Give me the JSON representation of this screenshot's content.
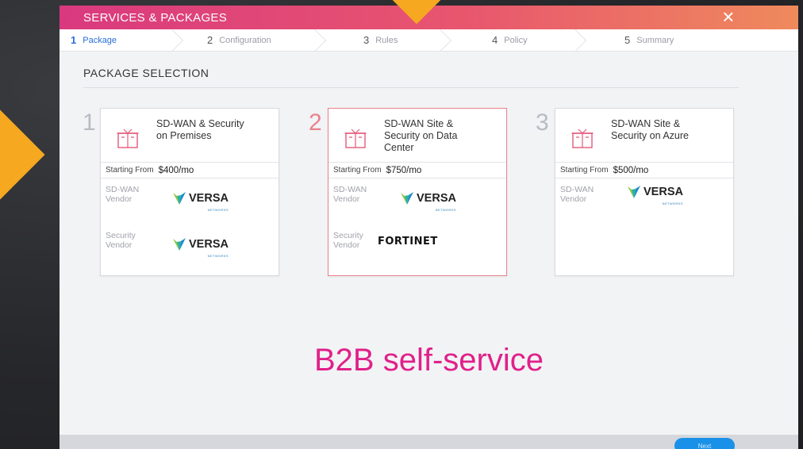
{
  "window": {
    "title": "SERVICES & PACKAGES"
  },
  "steps": [
    {
      "num": "1",
      "label": "Package"
    },
    {
      "num": "2",
      "label": "Configuration"
    },
    {
      "num": "3",
      "label": "Rules"
    },
    {
      "num": "4",
      "label": "Policy"
    },
    {
      "num": "5",
      "label": "Summary"
    }
  ],
  "section": {
    "title": "PACKAGE SELECTION"
  },
  "packages": [
    {
      "index": "1",
      "name": "SD-WAN & Security on Premises",
      "price_label": "Starting From",
      "price": "$400/mo",
      "sdwan_label": "SD-WAN Vendor",
      "sdwan_vendor": "VERSA",
      "sdwan_vendor_sub": "NETWORKS",
      "security_label": "Security Vendor",
      "security_vendor": "VERSA",
      "security_vendor_sub": "NETWORKS"
    },
    {
      "index": "2",
      "name": "SD-WAN Site & Security on Data Center",
      "price_label": "Starting From",
      "price": "$750/mo",
      "sdwan_label": "SD-WAN Vendor",
      "sdwan_vendor": "VERSA",
      "sdwan_vendor_sub": "NETWORKS",
      "security_label": "Security Vendor",
      "security_vendor": "FORTINET"
    },
    {
      "index": "3",
      "name": "SD-WAN Site & Security on Azure",
      "price_label": "Starting From",
      "price": "$500/mo",
      "sdwan_label": "SD-WAN Vendor",
      "sdwan_vendor": "VERSA",
      "sdwan_vendor_sub": "NETWORKS"
    }
  ],
  "caption": "B2B self-service",
  "footer": {
    "next_label": "Next"
  },
  "colors": {
    "accent": "#2a6fd6",
    "title_gradient_start": "#d9397f",
    "title_gradient_end": "#ef8a5c",
    "caption": "#e0218a",
    "pointer": "#f6a821",
    "selected_border": "#e8838c"
  },
  "icons": {
    "close": "close-icon",
    "package": "box-icon",
    "vendor_logo": "versa-logo-icon"
  }
}
